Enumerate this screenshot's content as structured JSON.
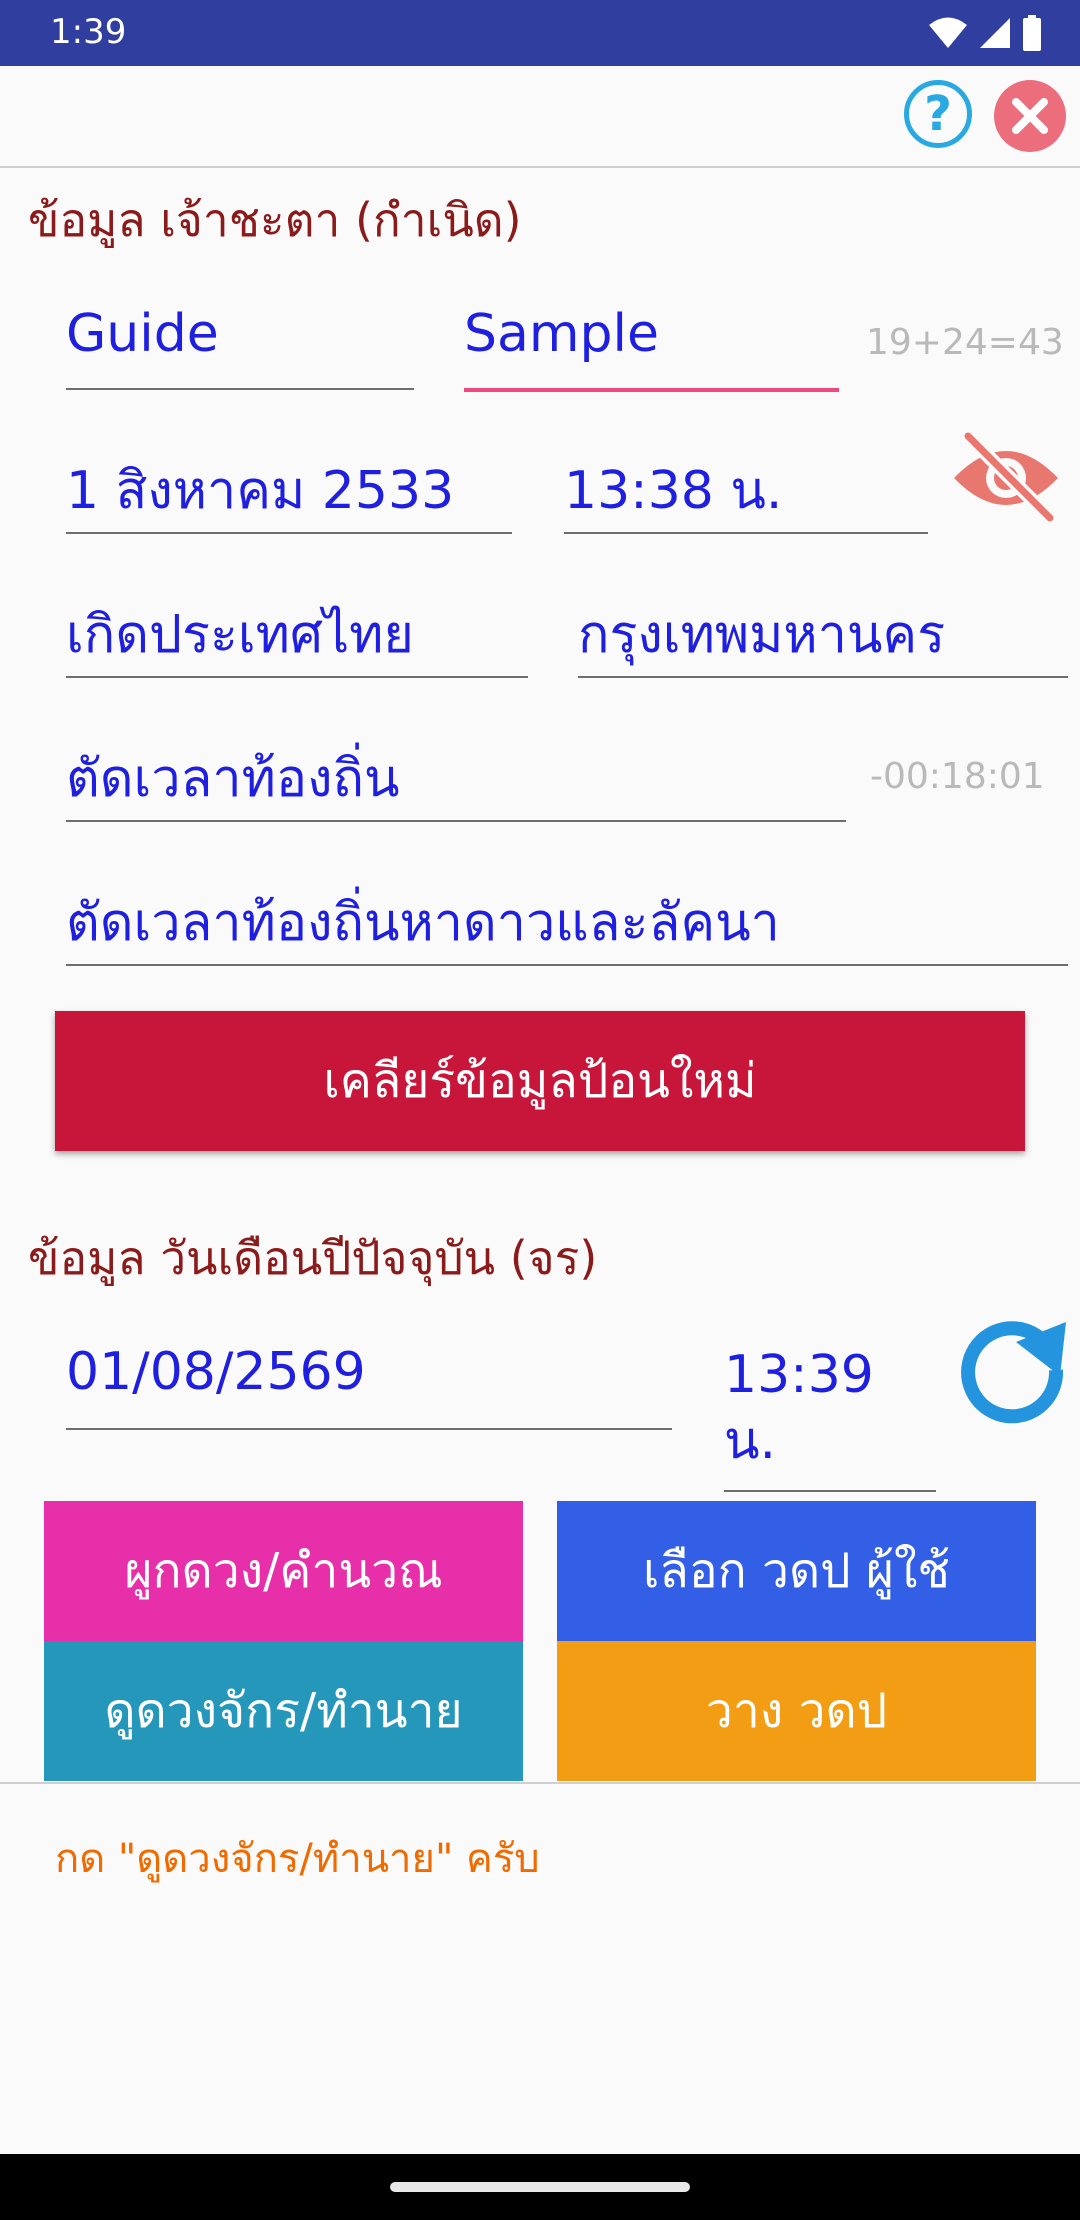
{
  "status_bar": {
    "time": "1:39"
  },
  "toolbar": {
    "help_icon": "?"
  },
  "birth_section": {
    "title": "ข้อมูล เจ้าชะตา (กำเนิด)",
    "first_name": "Guide",
    "last_name": "Sample",
    "name_count": "19+24=43",
    "date": "1 สิงหาคม 2533",
    "time": "13:38 น.",
    "country": "เกิดประเทศไทย",
    "province": "กรุงเทพมหานคร",
    "local_time_adjust": "ตัดเวลาท้องถิ่น",
    "local_time_offset": "-00:18:01",
    "local_time_adjust_planets": "ตัดเวลาท้องถิ่นหาดาวและลัคนา"
  },
  "clear_button_label": "เคลียร์ข้อมูลป้อนใหม่",
  "current_section": {
    "title": "ข้อมูล วันเดือนปีปัจจุบัน (จร)",
    "date": "01/08/2569",
    "time_line1": "13:39",
    "time_line2": "น."
  },
  "actions": {
    "bind_chart": "ผูกดวง/คำนวณ",
    "select_user_date": "เลือก วดป ผู้ใช้",
    "view_chart": "ดูดวงจักร/ทำนาย",
    "place_date": "วาง วดป"
  },
  "message": "กด \"ดูดวงจักร/ทำนาย\" ครับ",
  "colors": {
    "status_bar": "#303f9f",
    "accent_pink": "#ee4a7f",
    "clear_button": "#c8163a",
    "bind_button": "#e62fa9",
    "select_button": "#325fe6",
    "view_button": "#2497ba",
    "place_button": "#f39d14",
    "input_text": "#1f1fe0",
    "message_text": "#f06a00"
  }
}
